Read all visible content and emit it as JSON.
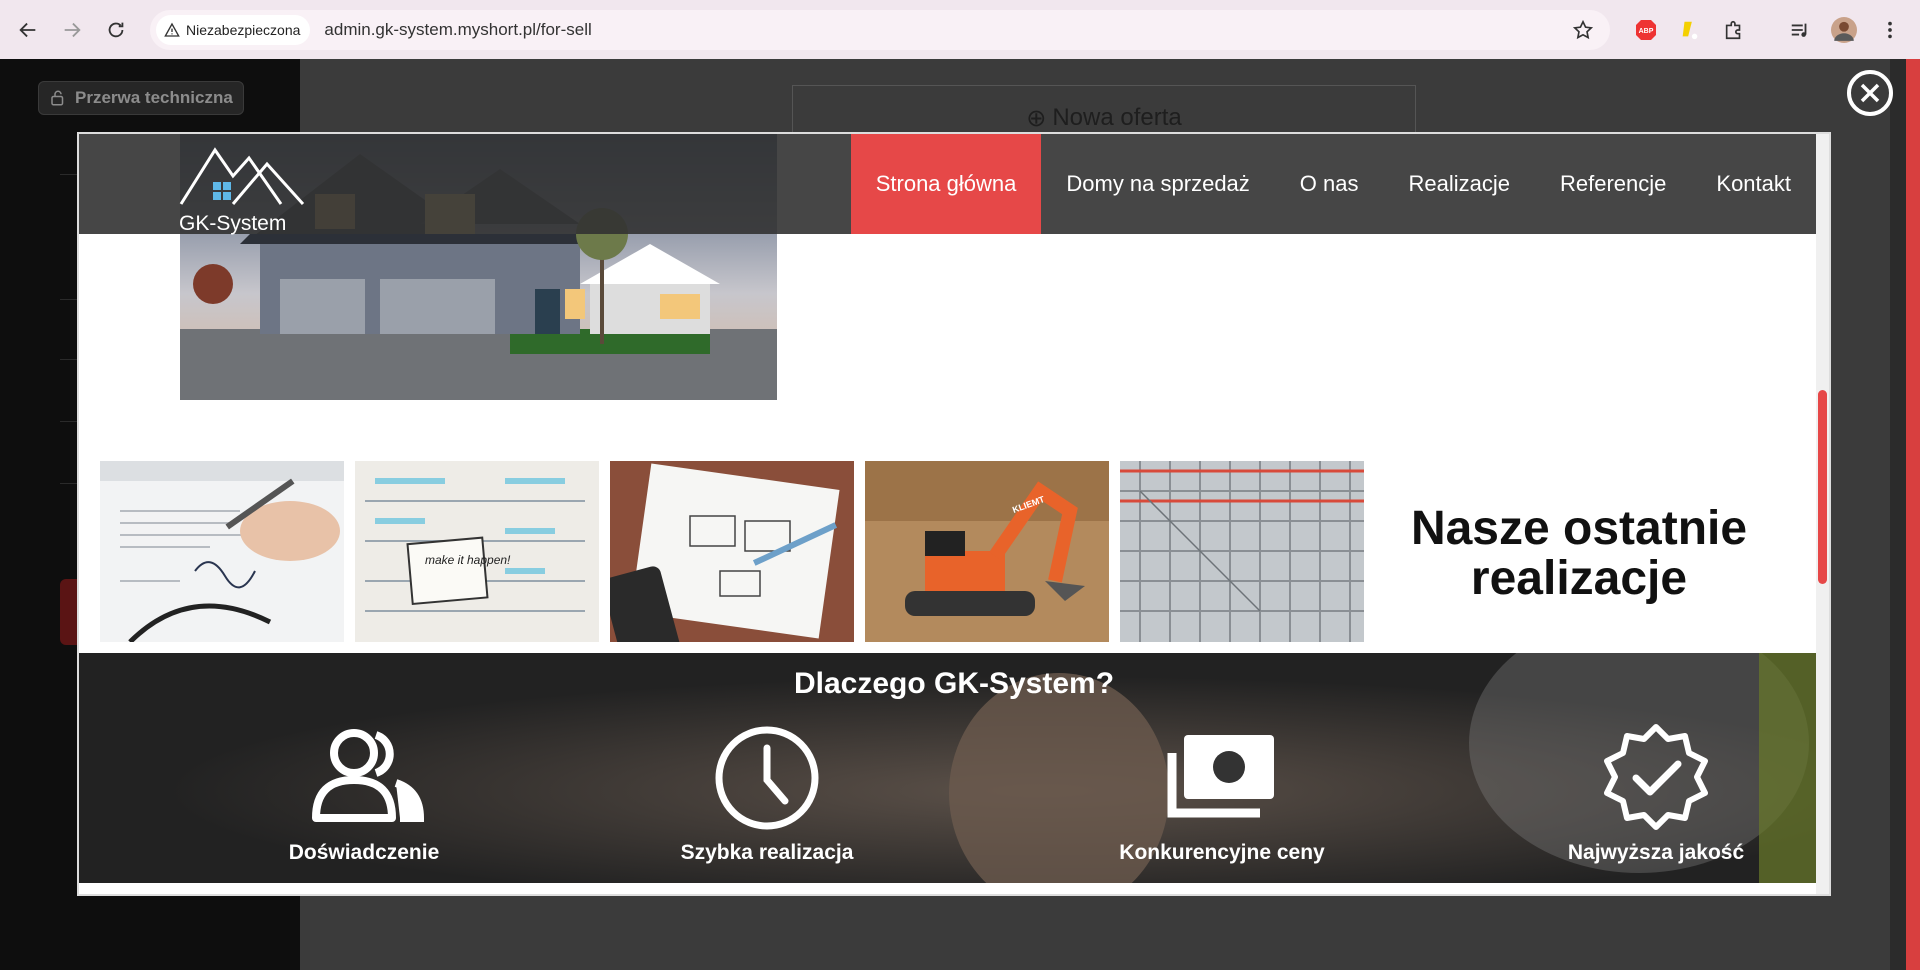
{
  "browser": {
    "security_label": "Niezabezpieczona",
    "url": "admin.gk-system.myshort.pl/for-sell"
  },
  "admin": {
    "maintenance_label": "Przerwa techniczna",
    "new_offer_label": "Nowa oferta",
    "accent_color": "#d83f3f"
  },
  "site": {
    "logo_text": "GK-System",
    "nav": [
      {
        "label": "Strona główna",
        "active": true
      },
      {
        "label": "Domy na sprzedaż"
      },
      {
        "label": "O nas"
      },
      {
        "label": "Realizacje"
      },
      {
        "label": "Referencje"
      },
      {
        "label": "Kontakt"
      }
    ],
    "realizacje_title_line1": "Nasze ostatnie",
    "realizacje_title_line2": "realizacje",
    "why_title": "Dlaczego GK-System?",
    "features": [
      {
        "label": "Doświadczenie",
        "icon": "users-icon"
      },
      {
        "label": "Szybka realizacja",
        "icon": "clock-icon"
      },
      {
        "label": "Konkurencyjne ceny",
        "icon": "money-icon"
      },
      {
        "label": "Najwyższa jakość",
        "icon": "quality-badge-icon"
      }
    ],
    "thumbnails": [
      "signature-photo",
      "notebook-make-it-happen-photo",
      "sketch-notebook-photo",
      "excavator-photo",
      "scaffolding-photo"
    ],
    "thumb_text": {
      "notebook": "make it happen!",
      "excavator": "KLIEMT"
    },
    "accent_color": "#e64848"
  }
}
